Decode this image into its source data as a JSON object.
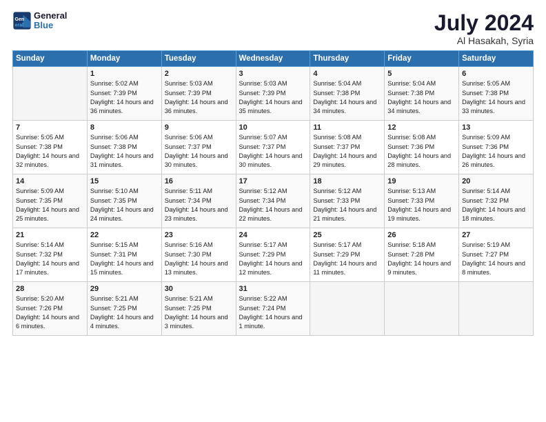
{
  "logo": {
    "line1": "General",
    "line2": "Blue"
  },
  "title": "July 2024",
  "location": "Al Hasakah, Syria",
  "days_of_week": [
    "Sunday",
    "Monday",
    "Tuesday",
    "Wednesday",
    "Thursday",
    "Friday",
    "Saturday"
  ],
  "weeks": [
    [
      {
        "day": "",
        "sunrise": "",
        "sunset": "",
        "daylight": ""
      },
      {
        "day": "1",
        "sunrise": "5:02 AM",
        "sunset": "7:39 PM",
        "daylight": "14 hours and 36 minutes."
      },
      {
        "day": "2",
        "sunrise": "5:03 AM",
        "sunset": "7:39 PM",
        "daylight": "14 hours and 36 minutes."
      },
      {
        "day": "3",
        "sunrise": "5:03 AM",
        "sunset": "7:39 PM",
        "daylight": "14 hours and 35 minutes."
      },
      {
        "day": "4",
        "sunrise": "5:04 AM",
        "sunset": "7:38 PM",
        "daylight": "14 hours and 34 minutes."
      },
      {
        "day": "5",
        "sunrise": "5:04 AM",
        "sunset": "7:38 PM",
        "daylight": "14 hours and 34 minutes."
      },
      {
        "day": "6",
        "sunrise": "5:05 AM",
        "sunset": "7:38 PM",
        "daylight": "14 hours and 33 minutes."
      }
    ],
    [
      {
        "day": "7",
        "sunrise": "5:05 AM",
        "sunset": "7:38 PM",
        "daylight": "14 hours and 32 minutes."
      },
      {
        "day": "8",
        "sunrise": "5:06 AM",
        "sunset": "7:38 PM",
        "daylight": "14 hours and 31 minutes."
      },
      {
        "day": "9",
        "sunrise": "5:06 AM",
        "sunset": "7:37 PM",
        "daylight": "14 hours and 30 minutes."
      },
      {
        "day": "10",
        "sunrise": "5:07 AM",
        "sunset": "7:37 PM",
        "daylight": "14 hours and 30 minutes."
      },
      {
        "day": "11",
        "sunrise": "5:08 AM",
        "sunset": "7:37 PM",
        "daylight": "14 hours and 29 minutes."
      },
      {
        "day": "12",
        "sunrise": "5:08 AM",
        "sunset": "7:36 PM",
        "daylight": "14 hours and 28 minutes."
      },
      {
        "day": "13",
        "sunrise": "5:09 AM",
        "sunset": "7:36 PM",
        "daylight": "14 hours and 26 minutes."
      }
    ],
    [
      {
        "day": "14",
        "sunrise": "5:09 AM",
        "sunset": "7:35 PM",
        "daylight": "14 hours and 25 minutes."
      },
      {
        "day": "15",
        "sunrise": "5:10 AM",
        "sunset": "7:35 PM",
        "daylight": "14 hours and 24 minutes."
      },
      {
        "day": "16",
        "sunrise": "5:11 AM",
        "sunset": "7:34 PM",
        "daylight": "14 hours and 23 minutes."
      },
      {
        "day": "17",
        "sunrise": "5:12 AM",
        "sunset": "7:34 PM",
        "daylight": "14 hours and 22 minutes."
      },
      {
        "day": "18",
        "sunrise": "5:12 AM",
        "sunset": "7:33 PM",
        "daylight": "14 hours and 21 minutes."
      },
      {
        "day": "19",
        "sunrise": "5:13 AM",
        "sunset": "7:33 PM",
        "daylight": "14 hours and 19 minutes."
      },
      {
        "day": "20",
        "sunrise": "5:14 AM",
        "sunset": "7:32 PM",
        "daylight": "14 hours and 18 minutes."
      }
    ],
    [
      {
        "day": "21",
        "sunrise": "5:14 AM",
        "sunset": "7:32 PM",
        "daylight": "14 hours and 17 minutes."
      },
      {
        "day": "22",
        "sunrise": "5:15 AM",
        "sunset": "7:31 PM",
        "daylight": "14 hours and 15 minutes."
      },
      {
        "day": "23",
        "sunrise": "5:16 AM",
        "sunset": "7:30 PM",
        "daylight": "14 hours and 13 minutes."
      },
      {
        "day": "24",
        "sunrise": "5:17 AM",
        "sunset": "7:29 PM",
        "daylight": "14 hours and 12 minutes."
      },
      {
        "day": "25",
        "sunrise": "5:17 AM",
        "sunset": "7:29 PM",
        "daylight": "14 hours and 11 minutes."
      },
      {
        "day": "26",
        "sunrise": "5:18 AM",
        "sunset": "7:28 PM",
        "daylight": "14 hours and 9 minutes."
      },
      {
        "day": "27",
        "sunrise": "5:19 AM",
        "sunset": "7:27 PM",
        "daylight": "14 hours and 8 minutes."
      }
    ],
    [
      {
        "day": "28",
        "sunrise": "5:20 AM",
        "sunset": "7:26 PM",
        "daylight": "14 hours and 6 minutes."
      },
      {
        "day": "29",
        "sunrise": "5:21 AM",
        "sunset": "7:25 PM",
        "daylight": "14 hours and 4 minutes."
      },
      {
        "day": "30",
        "sunrise": "5:21 AM",
        "sunset": "7:25 PM",
        "daylight": "14 hours and 3 minutes."
      },
      {
        "day": "31",
        "sunrise": "5:22 AM",
        "sunset": "7:24 PM",
        "daylight": "14 hours and 1 minute."
      },
      {
        "day": "",
        "sunrise": "",
        "sunset": "",
        "daylight": ""
      },
      {
        "day": "",
        "sunrise": "",
        "sunset": "",
        "daylight": ""
      },
      {
        "day": "",
        "sunrise": "",
        "sunset": "",
        "daylight": ""
      }
    ]
  ]
}
